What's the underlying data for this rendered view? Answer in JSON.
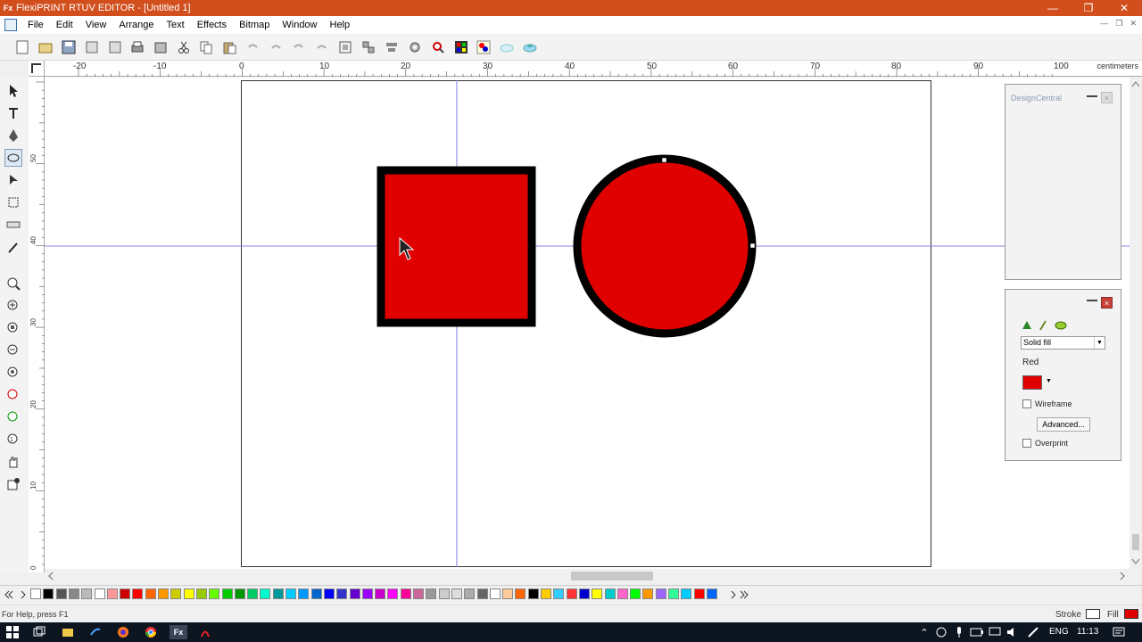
{
  "window": {
    "title": "FlexiPRINT RTUV EDITOR - [Untitled 1]",
    "app_icon_text": "Fx"
  },
  "menu": [
    "File",
    "Edit",
    "View",
    "Arrange",
    "Text",
    "Effects",
    "Bitmap",
    "Window",
    "Help"
  ],
  "ruler": {
    "h_labels": [
      "-20",
      "-10",
      "0",
      "10",
      "20",
      "30",
      "40",
      "50",
      "60",
      "70",
      "80",
      "90",
      "100"
    ],
    "unit": "centimeters",
    "v_labels": [
      "50",
      "40",
      "30",
      "20",
      "10",
      "0"
    ]
  },
  "panels": {
    "design_central": {
      "title": "DesignCentral"
    },
    "fill": {
      "fill_type": "Solid fill",
      "color_name": "Red",
      "color_hex": "#e00000",
      "wireframe_label": "Wireframe",
      "advanced_label": "Advanced...",
      "overprint_label": "Overprint"
    }
  },
  "canvas": {
    "shapes": [
      {
        "type": "rectangle",
        "fill": "#e00000",
        "stroke": "#000000"
      },
      {
        "type": "circle",
        "fill": "#e00000",
        "stroke": "#000000"
      }
    ]
  },
  "status": {
    "help_text": "For Help, press F1",
    "stroke_label": "Stroke",
    "fill_label": "Fill"
  },
  "taskbar": {
    "language": "ENG",
    "time": "11:13"
  },
  "palette_colors": [
    "#ffffff",
    "#000000",
    "#555555",
    "#888888",
    "#bbbbbb",
    "#ffffff",
    "#ff9999",
    "#cc0000",
    "#ff0000",
    "#ff6600",
    "#ff9900",
    "#cccc00",
    "#ffff00",
    "#99cc00",
    "#66ff00",
    "#00cc00",
    "#009900",
    "#00cc66",
    "#00ffcc",
    "#009999",
    "#00ccff",
    "#0099ff",
    "#0066cc",
    "#0000ff",
    "#3333cc",
    "#6600cc",
    "#9900ff",
    "#cc00cc",
    "#ff00ff",
    "#ff0099",
    "#cc6699",
    "#999999",
    "#cccccc",
    "#dddddd",
    "#aaaaaa",
    "#666666",
    "#ffffff",
    "#ffcc99",
    "#ff6600",
    "#000000",
    "#ffcc00",
    "#33ccff",
    "#ff3333",
    "#0000cc",
    "#ffff00",
    "#00cccc",
    "#ff66cc",
    "#00ff00",
    "#ff9900",
    "#9966ff",
    "#33ff99",
    "#00ccff",
    "#ff0000",
    "#0066ff"
  ]
}
